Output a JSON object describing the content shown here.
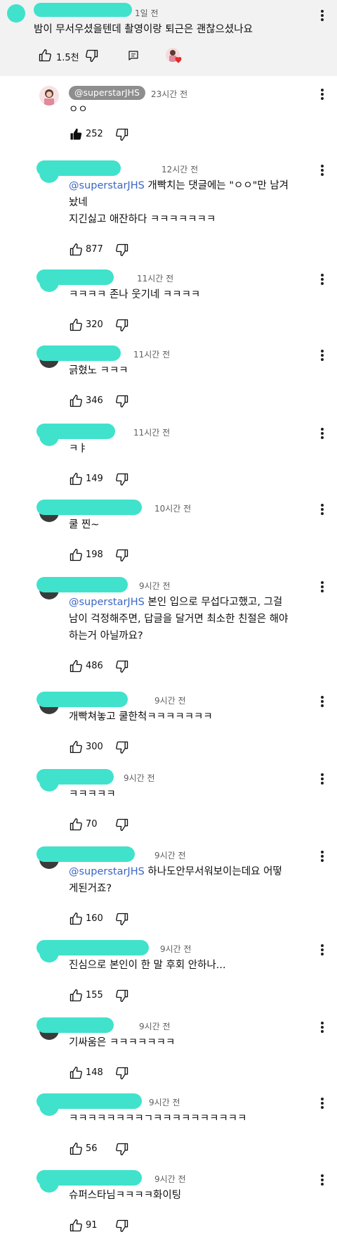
{
  "top_comment": {
    "time": "1일 전",
    "text": "밤이 무서우셨을텐데 촬영이랑 퇴근은 괜찮으셨나요",
    "likes": "1.5천"
  },
  "creator_reply": {
    "handle": "@superstarJHS",
    "time": "23시간 전",
    "text": "ㅇㅇ",
    "likes": "252"
  },
  "replies": [
    {
      "time": "12시간 전",
      "mention": "@superstarJHS",
      "line1": "개빡치는 댓글에는 \"ㅇㅇ\"만 남겨",
      "line2": "놨네",
      "line3": "지긴싫고 애잔하다 ㅋㅋㅋㅋㅋㅋㅋ",
      "likes": "877"
    },
    {
      "time": "11시간 전",
      "line1": "ㅋㅋㅋㅋ 존나 웃기네 ㅋㅋㅋㅋ",
      "likes": "320"
    },
    {
      "time": "11시간 전",
      "line1": "긁혔노 ㅋㅋㅋ",
      "likes": "346"
    },
    {
      "time": "11시간 전",
      "line1": "ㅋㅑ",
      "likes": "149"
    },
    {
      "time": "10시간 전",
      "line1": "쿨 찐~",
      "likes": "198"
    },
    {
      "time": "9시간 전",
      "mention": "@superstarJHS",
      "line1": "본인 입으로 무섭다고했고, 그걸",
      "line2": "남이 걱정해주면, 답글을 달거면 최소한 친절은 해야",
      "line3": "하는거 아닐까요?",
      "likes": "486"
    },
    {
      "time": "9시간 전",
      "line1": "개빡쳐놓고 쿨한척ㅋㅋㅋㅋㅋㅋㅋ",
      "likes": "300"
    },
    {
      "time": "9시간 전",
      "line1": "ㅋㅋㅋㅋㅋ",
      "likes": "70"
    },
    {
      "time": "9시간 전",
      "mention": "@superstarJHS",
      "line1": "하나도안무서워보이는데요 어떻",
      "line2": "게된거죠?",
      "likes": "160"
    },
    {
      "time": "9시간 전",
      "line1": "진심으로 본인이 한 말 후회 안하나...",
      "likes": "155"
    },
    {
      "time": "9시간 전",
      "line1": "기싸움은 ㅋㅋㅋㅋㅋㅋㅋ",
      "likes": "148"
    },
    {
      "time": "9시간 전",
      "line1": "ㅋㅋㅋㅋㅋㅋㅋㅋㄱㅋㅋㅋㅋㅋㅋㅋㅋㅋㅋ",
      "likes": "56"
    },
    {
      "time": "9시간 전",
      "line1": "슈퍼스타님ㅋㅋㅋㅋ화이팅",
      "likes": "91"
    }
  ],
  "colors": {
    "redaction": "#40e2cc",
    "mention": "#3a65c6",
    "top_bg": "#f2f2f2"
  }
}
